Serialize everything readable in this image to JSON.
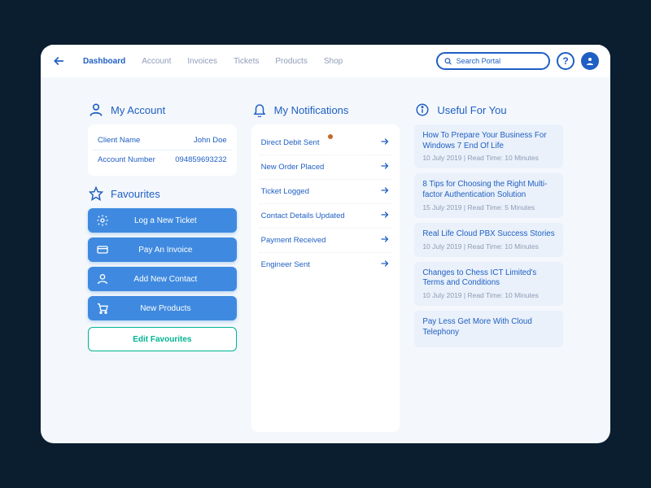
{
  "header": {
    "nav": [
      "Dashboard",
      "Account",
      "Invoices",
      "Tickets",
      "Products",
      "Shop"
    ],
    "active_index": 0,
    "search_placeholder": "Search Portal",
    "help_label": "?"
  },
  "account": {
    "title": "My Account",
    "rows": [
      {
        "label": "Client Name",
        "value": "John Doe"
      },
      {
        "label": "Account Number",
        "value": "094859693232"
      }
    ]
  },
  "favourites": {
    "title": "Favourites",
    "buttons": [
      {
        "label": "Log a New Ticket",
        "icon": "gear-icon"
      },
      {
        "label": "Pay An Invoice",
        "icon": "card-icon"
      },
      {
        "label": "Add New Contact",
        "icon": "user-icon"
      },
      {
        "label": "New Products",
        "icon": "cart-icon"
      }
    ],
    "edit_label": "Edit Favourites"
  },
  "notifications": {
    "title": "My Notifications",
    "items": [
      {
        "label": "Direct Debit Sent",
        "badge": true
      },
      {
        "label": "New Order Placed",
        "badge": false
      },
      {
        "label": "Ticket Logged",
        "badge": false
      },
      {
        "label": "Contact Details Updated",
        "badge": false
      },
      {
        "label": "Payment Received",
        "badge": false
      },
      {
        "label": "Engineer Sent",
        "badge": false
      }
    ]
  },
  "useful": {
    "title": "Useful For You",
    "items": [
      {
        "title": "How To Prepare Your Business For Windows 7 End Of Life",
        "meta": "10 July 2019 | Read Time: 10 Minutes"
      },
      {
        "title": "8 Tips for Choosing the Right Multi-factor Authentication Solution",
        "meta": "15 July 2019 | Read Time: 5 Minutes"
      },
      {
        "title": "Real Life Cloud PBX Success Stories",
        "meta": "10 July 2019 | Read Time: 10 Minutes"
      },
      {
        "title": "Changes to Chess ICT Limited's Terms and Conditions",
        "meta": "10 July 2019 | Read Time: 10 Minutes"
      },
      {
        "title": "Pay Less Get More With Cloud Telephony",
        "meta": ""
      }
    ]
  }
}
